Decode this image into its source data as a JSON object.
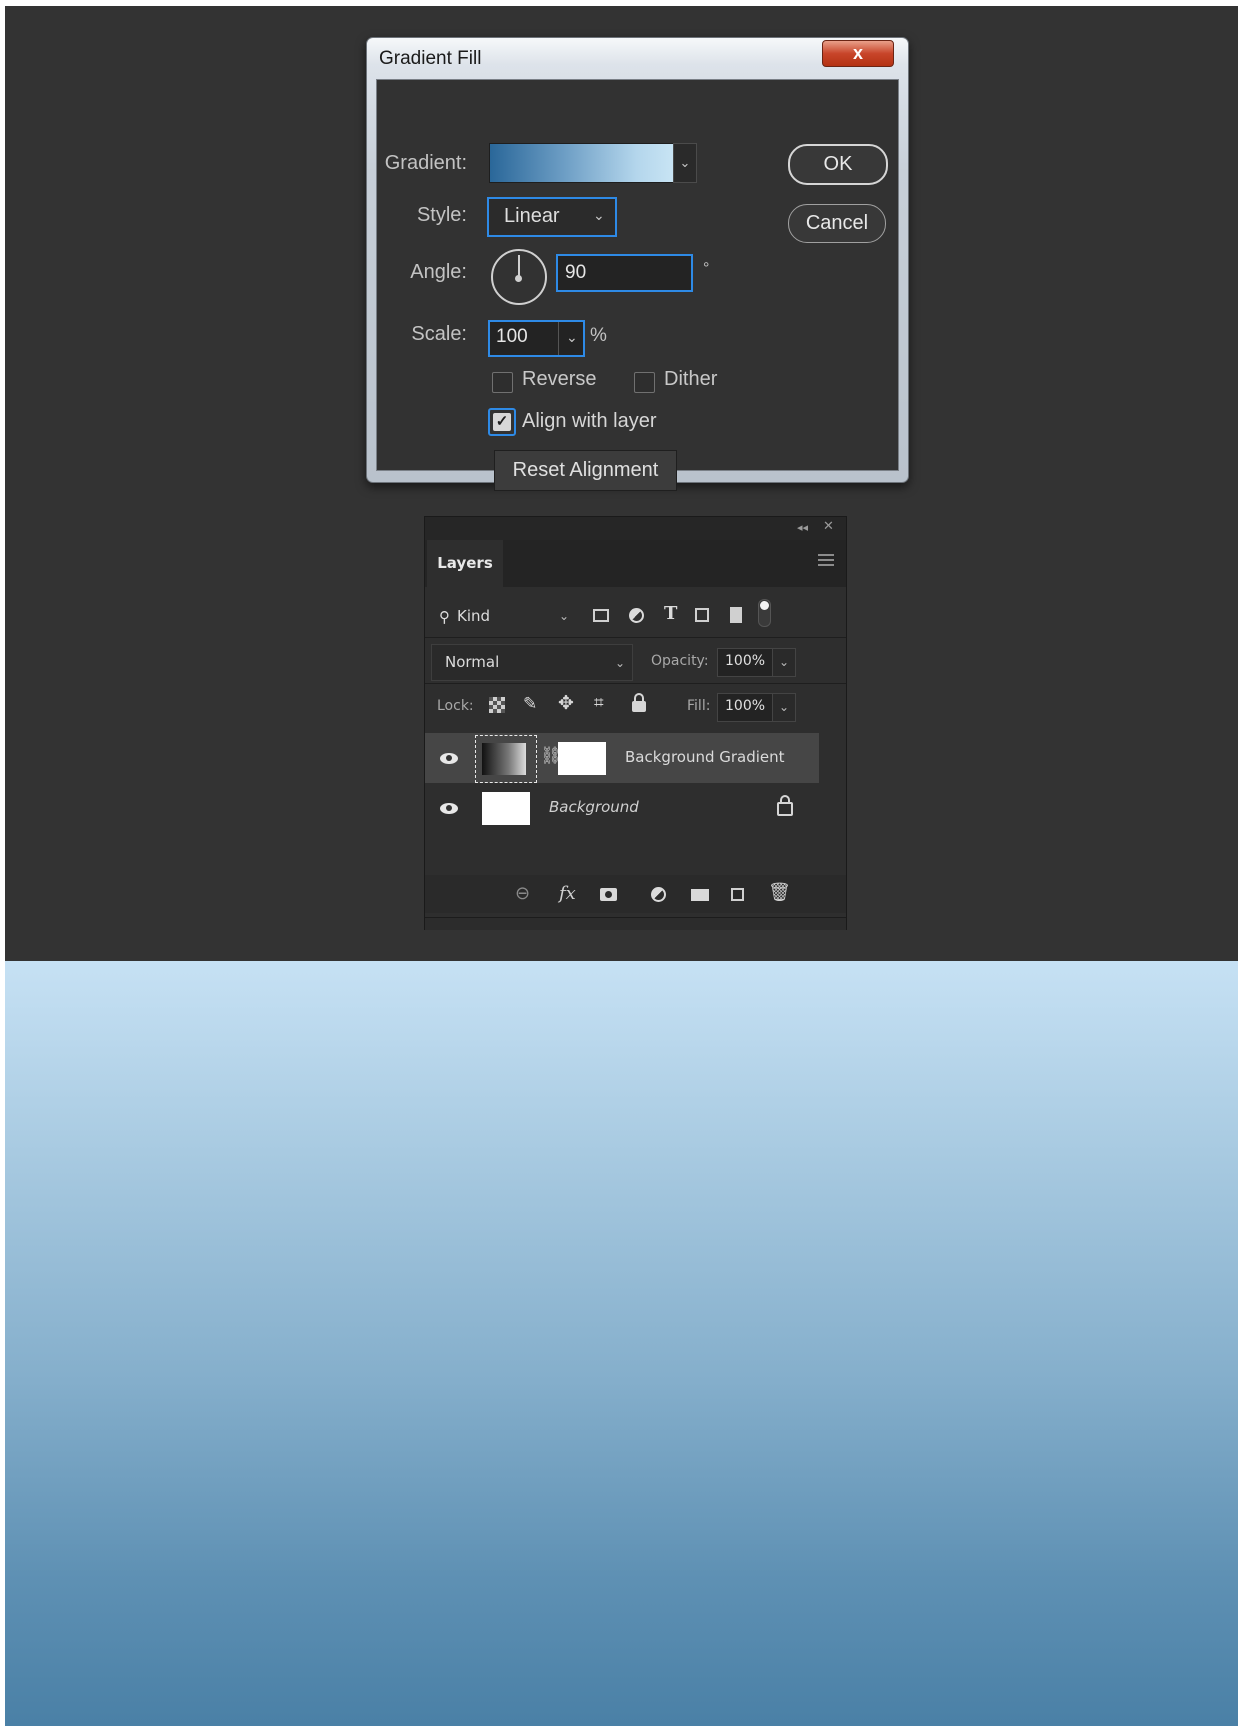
{
  "dialog": {
    "title": "Gradient Fill",
    "close_glyph": "x",
    "gradient_label": "Gradient:",
    "style_label": "Style:",
    "style_value": "Linear",
    "angle_label": "Angle:",
    "angle_value": "90",
    "degree_unit": "°",
    "scale_label": "Scale:",
    "scale_value": "100",
    "percent_unit": "%",
    "reverse_label": "Reverse",
    "reverse_checked": false,
    "dither_label": "Dither",
    "dither_checked": false,
    "align_label": "Align with layer",
    "align_checked": true,
    "reset_button": "Reset Alignment",
    "ok_button": "OK",
    "cancel_button": "Cancel",
    "gradient_colors": [
      "#2a6799",
      "#c8e4f4"
    ],
    "accent": "#2e8ae6"
  },
  "layers_panel": {
    "tab": "Layers",
    "kind_label": "Kind",
    "blend_mode": "Normal",
    "opacity_label": "Opacity:",
    "opacity_value": "100%",
    "lock_label": "Lock:",
    "fill_label": "Fill:",
    "fill_value": "100%",
    "filter_icons": [
      "pixel-layer-filter",
      "adjustment-layer-filter",
      "type-layer-filter",
      "shape-layer-filter",
      "smart-object-filter"
    ],
    "lock_icons": [
      "lock-transparent-pixels",
      "lock-image-pixels",
      "lock-position",
      "lock-artboard",
      "lock-all"
    ],
    "layers": [
      {
        "name": "Background Gradient",
        "visible": true,
        "selected": true
      },
      {
        "name": "Background",
        "visible": true,
        "locked": true
      }
    ],
    "bottom_icons": [
      "link-layers",
      "fx",
      "add-mask",
      "new-adjustment",
      "new-group",
      "new-layer",
      "delete"
    ],
    "fx_label": "fx"
  },
  "canvas": {
    "gradient_top": "#c6e1f4",
    "gradient_bottom": "#4a80a6"
  }
}
